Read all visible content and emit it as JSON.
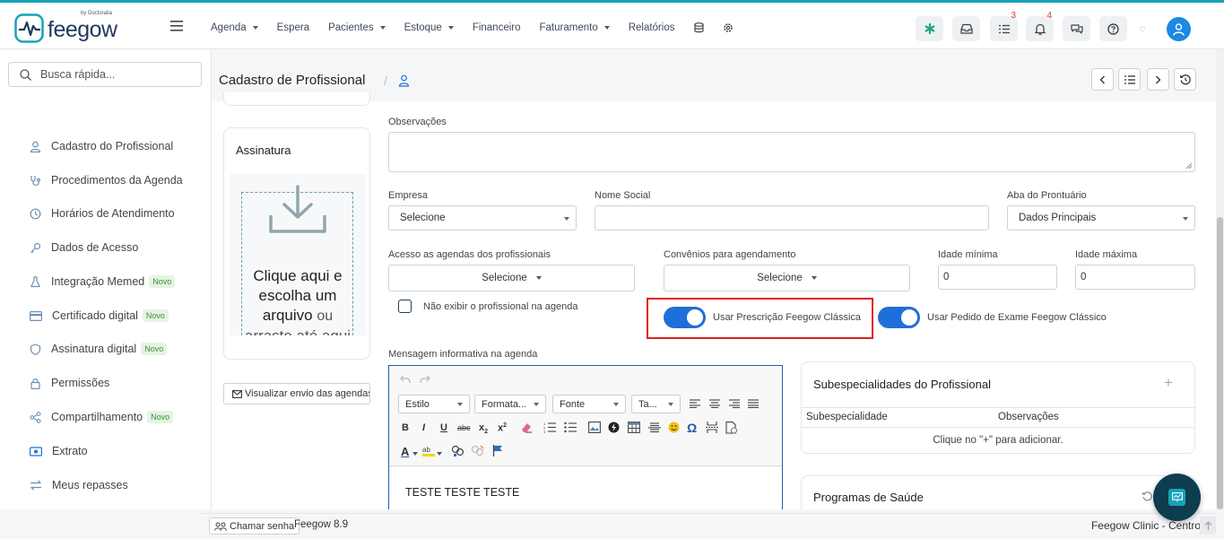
{
  "brand": {
    "name": "feegow",
    "by": "by Doctoralia",
    "accent": "#17a2b8",
    "primary": "#1e6fd9"
  },
  "nav": {
    "items": [
      {
        "label": "Agenda",
        "dropdown": true
      },
      {
        "label": "Espera",
        "dropdown": false
      },
      {
        "label": "Pacientes",
        "dropdown": true
      },
      {
        "label": "Estoque",
        "dropdown": true
      },
      {
        "label": "Financeiro",
        "dropdown": false
      },
      {
        "label": "Faturamento",
        "dropdown": true
      },
      {
        "label": "Relatórios",
        "dropdown": false
      }
    ]
  },
  "toolbar": {
    "tasks_badge": "3",
    "notifications_badge": "4"
  },
  "search": {
    "placeholder": "Busca rápida..."
  },
  "sidebar": {
    "items": [
      {
        "label": "Cadastro do Profissional",
        "icon": "user-icon",
        "badge": ""
      },
      {
        "label": "Procedimentos da Agenda",
        "icon": "stethoscope-icon",
        "badge": ""
      },
      {
        "label": "Horários de Atendimento",
        "icon": "clock-icon",
        "badge": ""
      },
      {
        "label": "Dados de Acesso",
        "icon": "key-icon",
        "badge": ""
      },
      {
        "label": "Integração Memed",
        "icon": "flask-icon",
        "badge": "Novo"
      },
      {
        "label": "Certificado digital",
        "icon": "card-icon",
        "badge": "Novo"
      },
      {
        "label": "Assinatura digital",
        "icon": "shield-icon",
        "badge": "Novo"
      },
      {
        "label": "Permissões",
        "icon": "lock-icon",
        "badge": ""
      },
      {
        "label": "Compartilhamento",
        "icon": "share-icon",
        "badge": "Novo"
      },
      {
        "label": "Extrato",
        "icon": "money-icon",
        "badge": ""
      },
      {
        "label": "Meus repasses",
        "icon": "transfer-icon",
        "badge": ""
      }
    ]
  },
  "page": {
    "title": "Cadastro de Profissional"
  },
  "signature": {
    "title": "Assinatura",
    "upload_line1": "Clique aqui e",
    "upload_line2": "escolha um",
    "upload_line3": "arquivo",
    "upload_or": "ou",
    "upload_line4": "arraste até aqui",
    "preview_button": "Visualizar envio das agendas"
  },
  "form": {
    "observacoes_label": "Observações",
    "empresa_label": "Empresa",
    "empresa_value": "Selecione",
    "nome_social_label": "Nome Social",
    "nome_social_value": "",
    "aba_label": "Aba do Prontuário",
    "aba_value": "Dados Principais",
    "acesso_label": "Acesso as agendas dos profissionais",
    "acesso_value": "Selecione",
    "convenios_label": "Convênios para agendamento",
    "convenios_value": "Selecione",
    "idade_min_label": "Idade mínima",
    "idade_min_value": "0",
    "idade_max_label": "Idade máxima",
    "idade_max_value": "0",
    "nao_exibir_label": "Não exibir o profissional na agenda",
    "nao_exibir_checked": false,
    "prescricao_label": "Usar Prescrição Feegow Clássica",
    "prescricao_on": true,
    "pedido_exame_label": "Usar Pedido de Exame Feegow Clássico",
    "pedido_exame_on": true,
    "mensagem_label": "Mensagem informativa na agenda"
  },
  "editor": {
    "style_combo": "Estilo",
    "format_combo": "Formata...",
    "font_combo": "Fonte",
    "size_combo": "Ta...",
    "content": "TESTE TESTE TESTE"
  },
  "subespecialidades": {
    "title": "Subespecialidades do Profissional",
    "col1": "Subespecialidade",
    "col2": "Observações",
    "empty": "Clique no \"+\" para adicionar."
  },
  "programas": {
    "title": "Programas de Saúde"
  },
  "statusbar": {
    "chamar_senha": "Chamar senha",
    "version": "Feegow 8.9",
    "clinic": "Feegow Clinic - Centro"
  }
}
